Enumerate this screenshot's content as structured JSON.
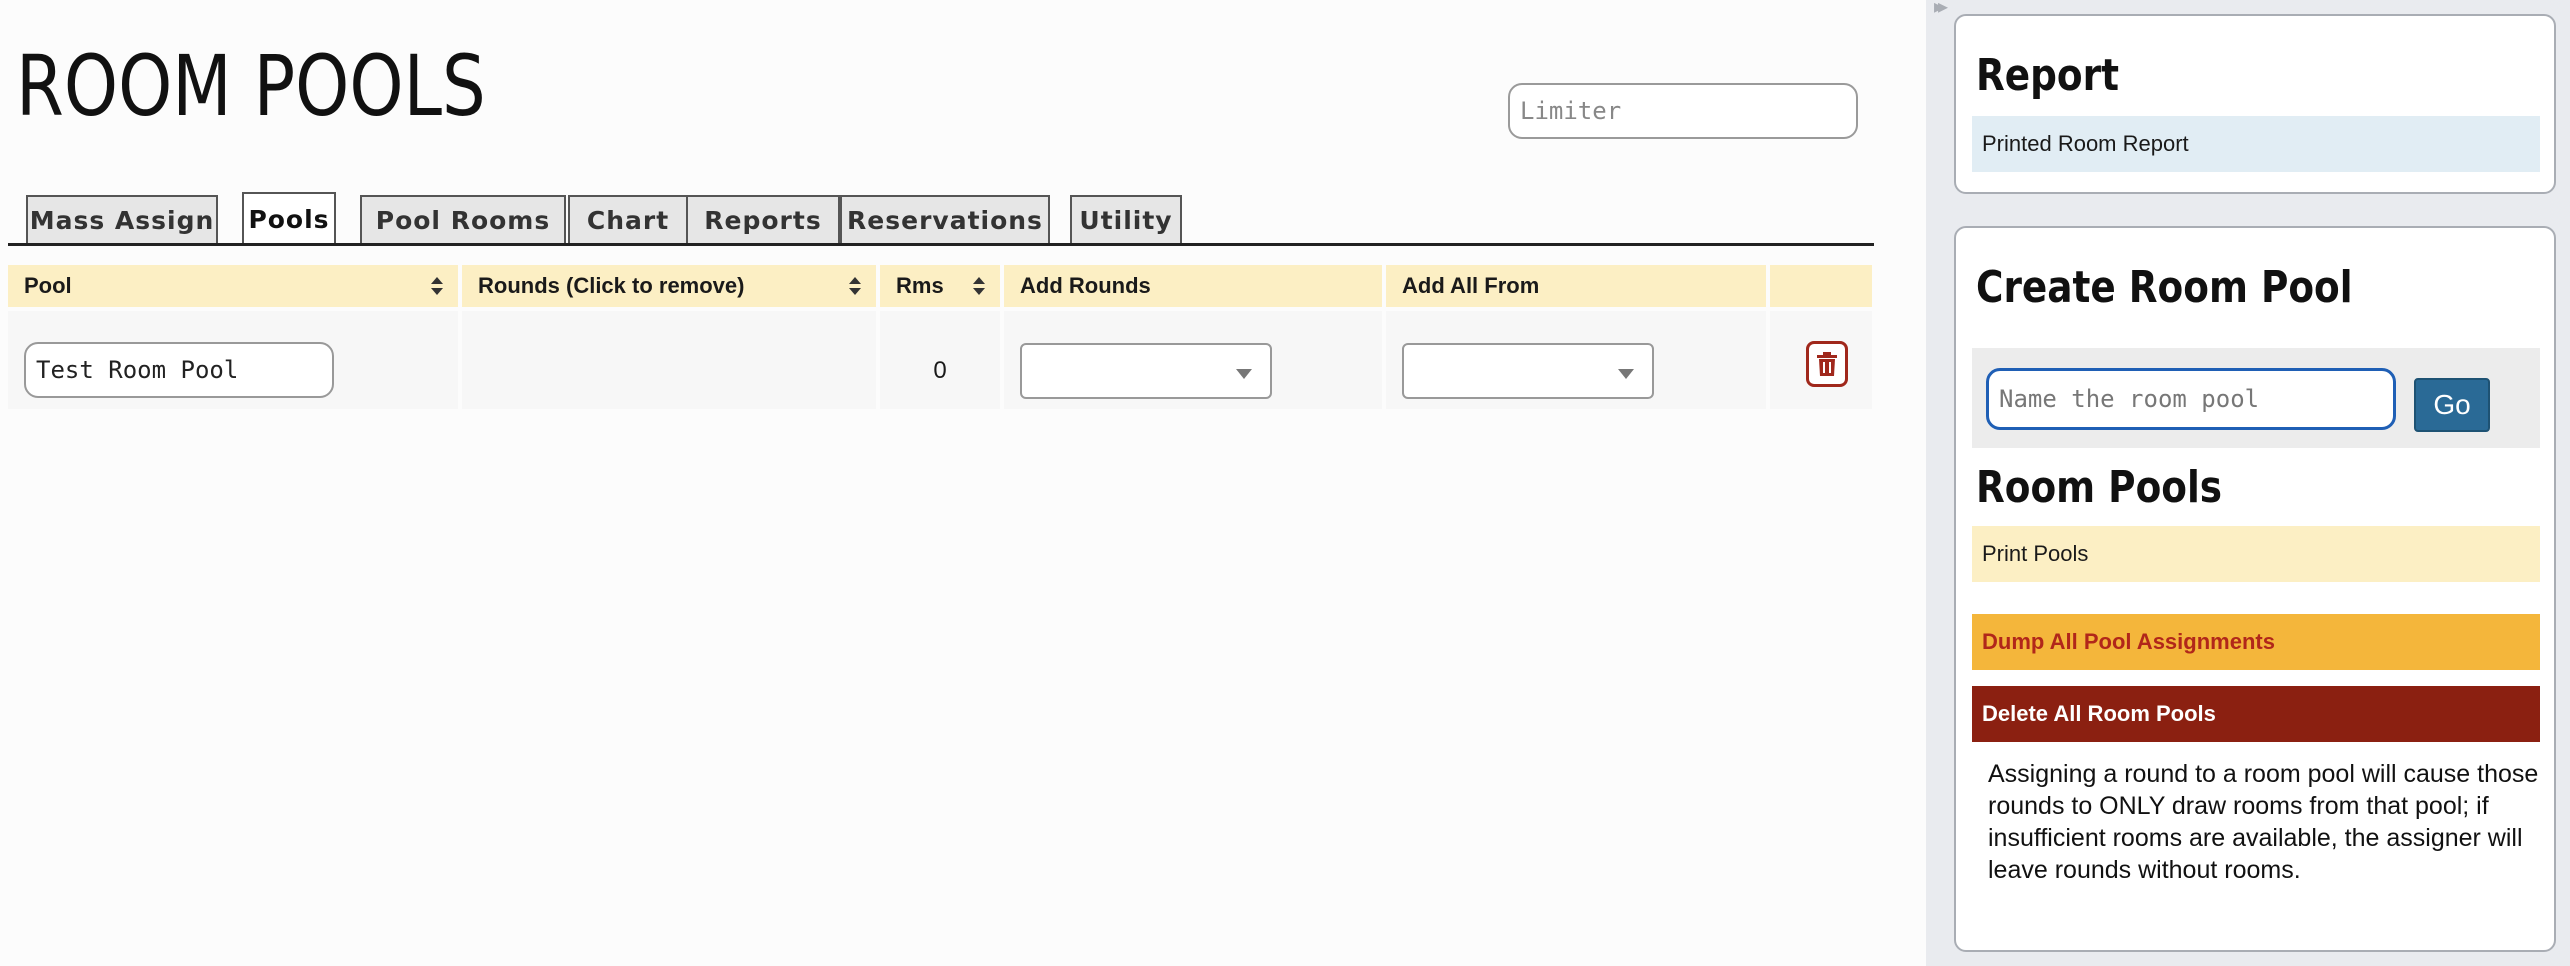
{
  "page": {
    "title": "ROOM POOLS"
  },
  "limiter": {
    "placeholder": "Limiter"
  },
  "tabs": [
    {
      "label": "Mass Assign",
      "active": false
    },
    {
      "label": "Pools",
      "active": true
    },
    {
      "label": "Pool Rooms",
      "active": false
    },
    {
      "label": "Chart",
      "active": false
    },
    {
      "label": "Reports",
      "active": false
    },
    {
      "label": "Reservations",
      "active": false
    },
    {
      "label": "Utility",
      "active": false
    }
  ],
  "table": {
    "headers": {
      "pool": "Pool",
      "rounds": "Rounds (Click to remove)",
      "rms": "Rms",
      "add_rounds": "Add Rounds",
      "add_all_from": "Add All From"
    },
    "rows": [
      {
        "pool_name": "Test Room Pool",
        "rounds": "",
        "rms": "0",
        "add_rounds": "",
        "add_all_from": ""
      }
    ]
  },
  "sidebar": {
    "report": {
      "heading": "Report",
      "link": "Printed Room Report"
    },
    "create": {
      "heading": "Create Room Pool",
      "input_placeholder": "Name the room pool",
      "go_label": "Go",
      "pools_heading": "Room Pools",
      "print_pools": "Print Pools",
      "dump_assignments": "Dump All Pool Assignments",
      "delete_all": "Delete All Room Pools",
      "help": "Assigning a round to a room pool will cause those rounds to ONLY draw rooms from that pool; if insufficient rooms are available, the assigner will leave rounds without rooms."
    }
  },
  "colors": {
    "header_bg": "#fcefc4",
    "link_blue": "#e1edf4",
    "dump_orange": "#f4b63b",
    "delete_red": "#8b2011",
    "go_blue": "#2a6a96",
    "trash_red": "#a0281c"
  },
  "icons": {
    "sort": "sort-icon",
    "trash": "trash-icon",
    "caret": "chevron-down-icon",
    "collapse": "double-chevron-right-icon"
  }
}
